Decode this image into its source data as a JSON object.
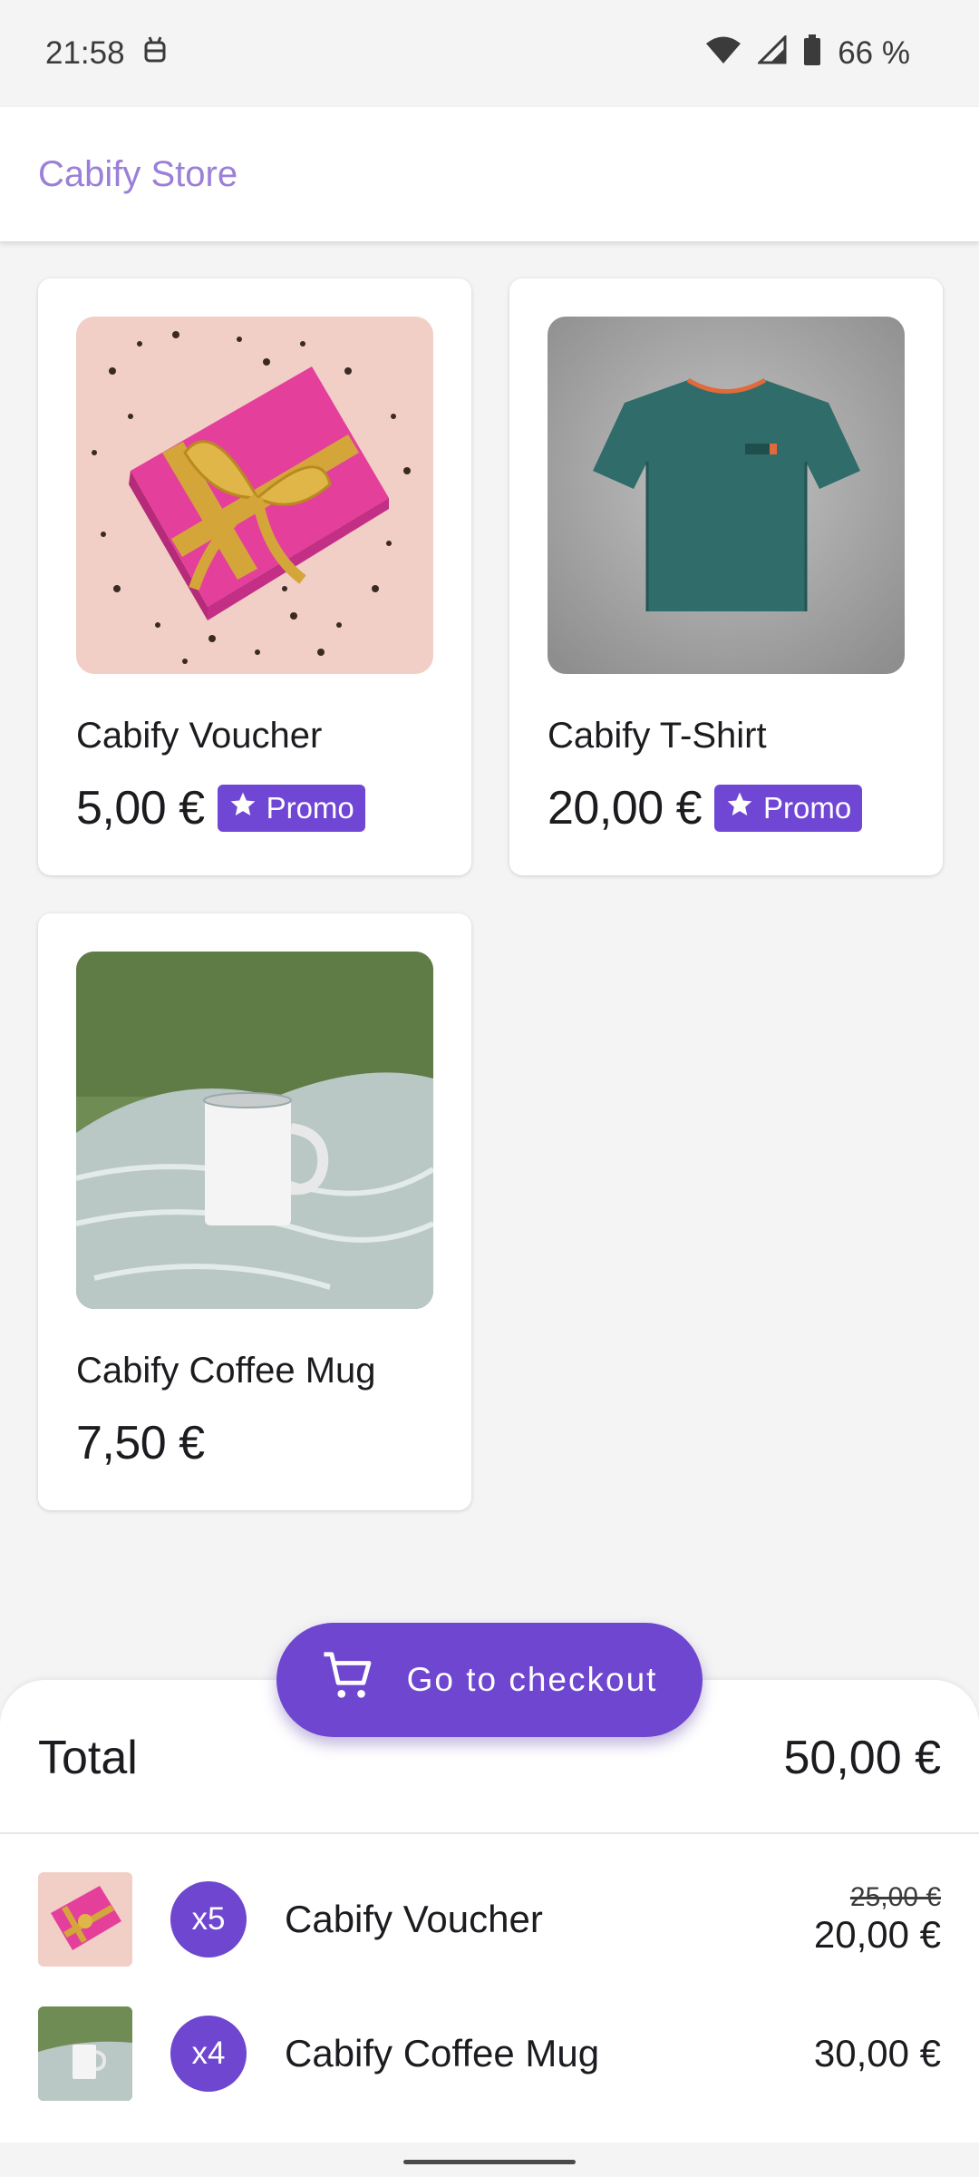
{
  "status_bar": {
    "time": "21:58",
    "battery": "66 %",
    "icons": [
      "android-debug-icon",
      "wifi-icon",
      "cell-signal-icon",
      "battery-icon"
    ]
  },
  "app_bar": {
    "title": "Cabify Store"
  },
  "products": [
    {
      "name": "Cabify Voucher",
      "price": "5,00 €",
      "promo": true,
      "promo_label": "Promo",
      "image": "gift-box-photo"
    },
    {
      "name": "Cabify T-Shirt",
      "price": "20,00 €",
      "promo": true,
      "promo_label": "Promo",
      "image": "green-tshirt-photo"
    },
    {
      "name": "Cabify Coffee Mug",
      "price": "7,50 €",
      "promo": false,
      "image": "white-mug-photo"
    }
  ],
  "checkout": {
    "label": "Go to checkout",
    "icon": "cart-icon"
  },
  "cart": {
    "total_label": "Total",
    "total_value": "50,00 €",
    "items": [
      {
        "qty": "x5",
        "name": "Cabify Voucher",
        "original_price": "25,00 €",
        "price": "20,00 €",
        "image": "gift-box-photo"
      },
      {
        "qty": "x4",
        "name": "Cabify Coffee Mug",
        "price": "30,00 €",
        "image": "white-mug-photo"
      }
    ]
  },
  "colors": {
    "accent": "#6e46cf",
    "title": "#9b7fd8",
    "background": "#f4f4f4"
  }
}
